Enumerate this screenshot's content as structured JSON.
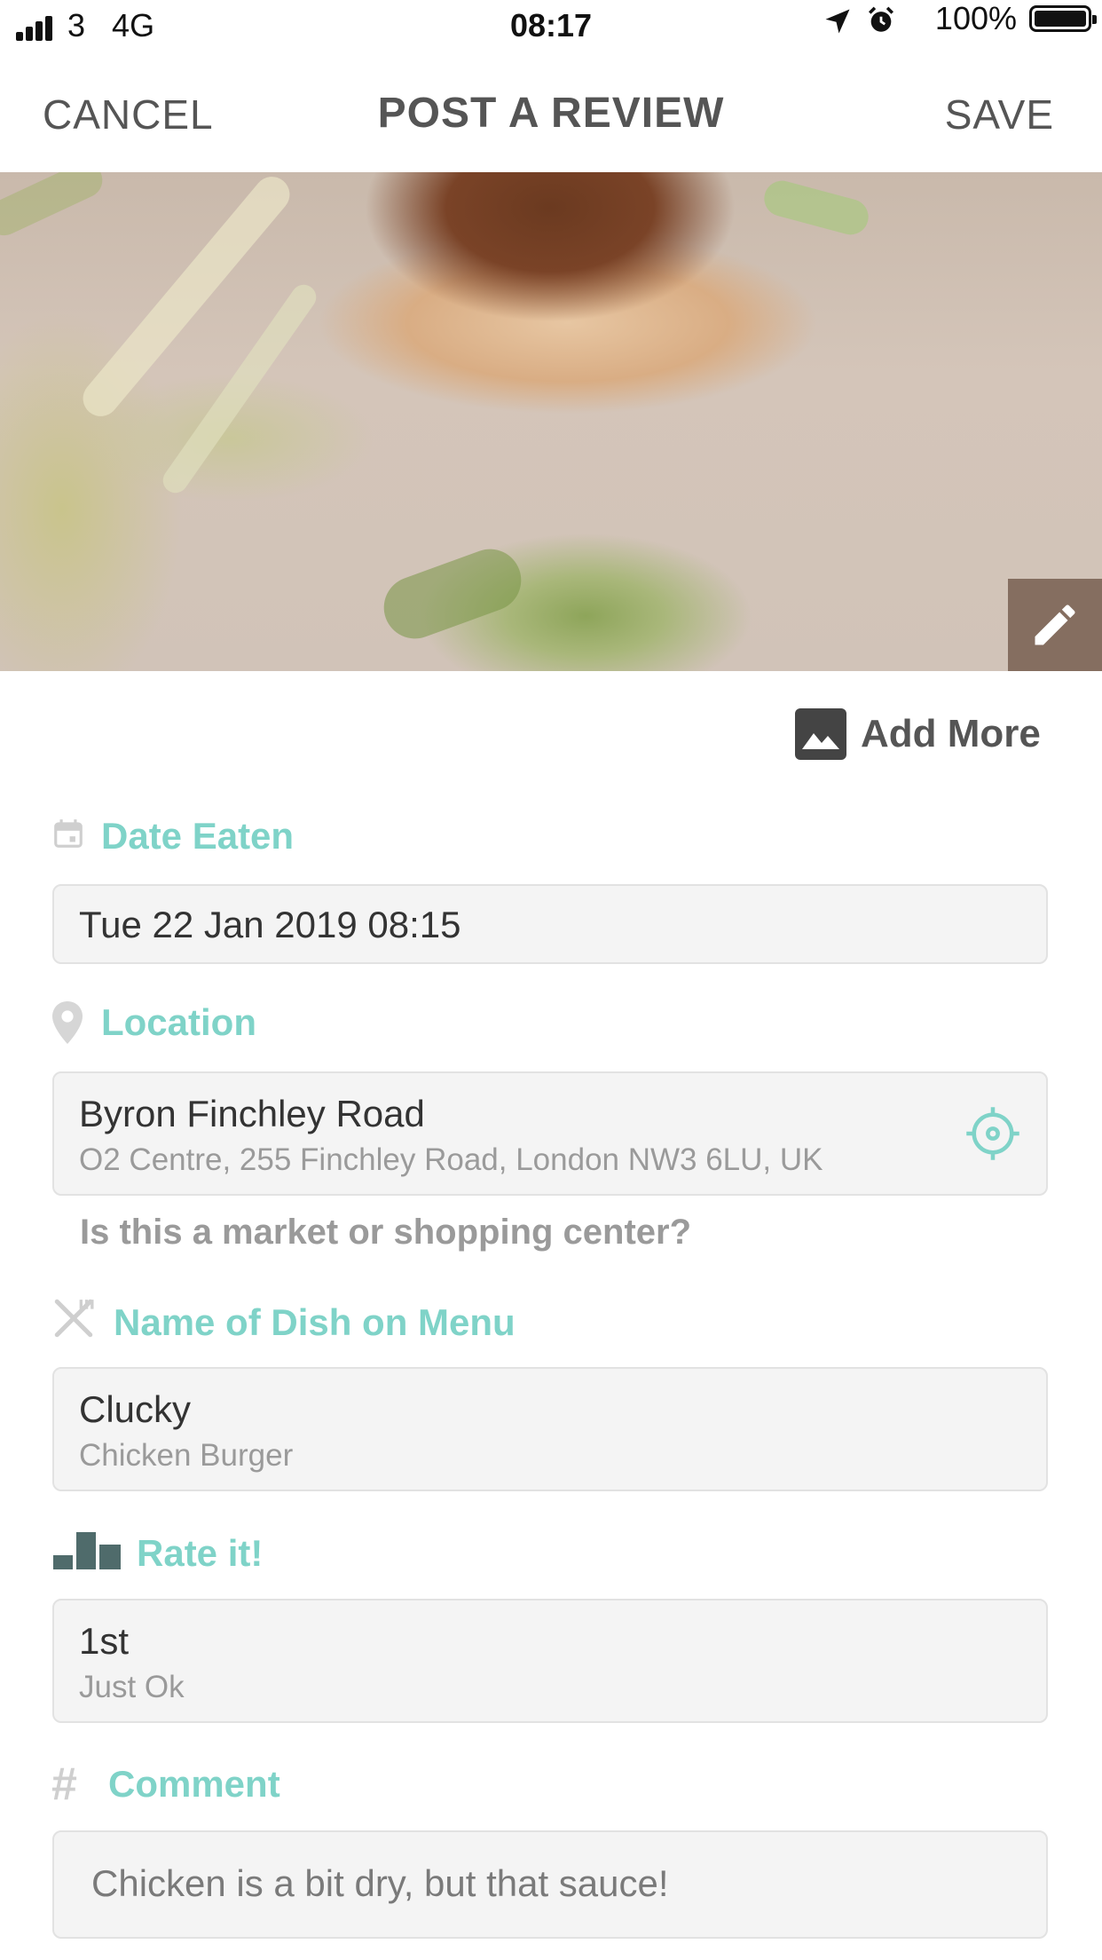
{
  "status_bar": {
    "signal_bars": 4,
    "carrier": "3",
    "network": "4G",
    "time": "08:17",
    "battery_percent": "100%"
  },
  "nav": {
    "cancel": "CANCEL",
    "title": "POST A REVIEW",
    "save": "SAVE"
  },
  "photo": {
    "edit_icon": "pencil-icon"
  },
  "add_more": {
    "icon": "image-icon",
    "label": "Add More"
  },
  "date": {
    "icon": "calendar-icon",
    "label": "Date Eaten",
    "value": "Tue 22 Jan 2019 08:15"
  },
  "location": {
    "icon": "map-pin-icon",
    "label": "Location",
    "name": "Byron Finchley Road",
    "address": "O2 Centre, 255 Finchley Road, London NW3 6LU, UK",
    "locate_icon": "crosshair-icon",
    "market_question": "Is this a market or shopping center?"
  },
  "dish": {
    "icon": "cutlery-icon",
    "label": "Name of Dish on Menu",
    "name": "Clucky",
    "description": "Chicken Burger"
  },
  "rating": {
    "icon": "podium-icon",
    "label": "Rate it!",
    "value": "1st",
    "description": "Just Ok"
  },
  "comment": {
    "icon": "hashtag-icon",
    "label": "Comment",
    "value": "Chicken is a bit dry, but that sauce!"
  },
  "colors": {
    "accent": "#7fd3c8",
    "field_bg": "#f4f4f4",
    "text_dark": "#333333",
    "text_muted": "#9a9a9a",
    "podium": "#4f6b6b"
  }
}
